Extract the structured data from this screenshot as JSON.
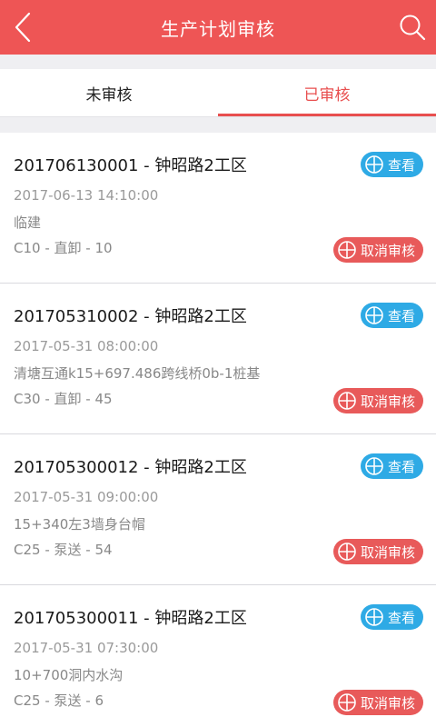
{
  "header": {
    "title": "生产计划审核",
    "back_icon": "chevron-left-icon",
    "search_icon": "search-icon",
    "color": "#ee5555"
  },
  "tabs": [
    {
      "label": "未审核",
      "active": false
    },
    {
      "label": "已审核",
      "active": true
    }
  ],
  "records": [
    {
      "code": "201706130001 - 钟昭路2工区",
      "time": "2017-06-13 14:10:00",
      "part": "临建",
      "spec": "C10 - 直卸 - 10",
      "view_label": "查看",
      "cancel_label": "取消审核"
    },
    {
      "code": "201705310002 - 钟昭路2工区",
      "time": "2017-05-31 08:00:00",
      "part": "清塘互通k15+697.486跨线桥0b-1桩基",
      "spec": "C30 - 直卸 - 45",
      "view_label": "查看",
      "cancel_label": "取消审核"
    },
    {
      "code": "201705300012 - 钟昭路2工区",
      "time": "2017-05-31 09:00:00",
      "part": "15+340左3墙身台帽",
      "spec": "C25 - 泵送 - 54",
      "view_label": "查看",
      "cancel_label": "取消审核"
    },
    {
      "code": "201705300011 - 钟昭路2工区",
      "time": "2017-05-31 07:30:00",
      "part": "10+700洞内水沟",
      "spec": "C25 - 泵送 - 6",
      "view_label": "查看",
      "cancel_label": "取消审核"
    }
  ],
  "colors": {
    "accent": "#e84f4f",
    "view_button": "#2eaae5",
    "cancel_button": "#e85a5a"
  }
}
